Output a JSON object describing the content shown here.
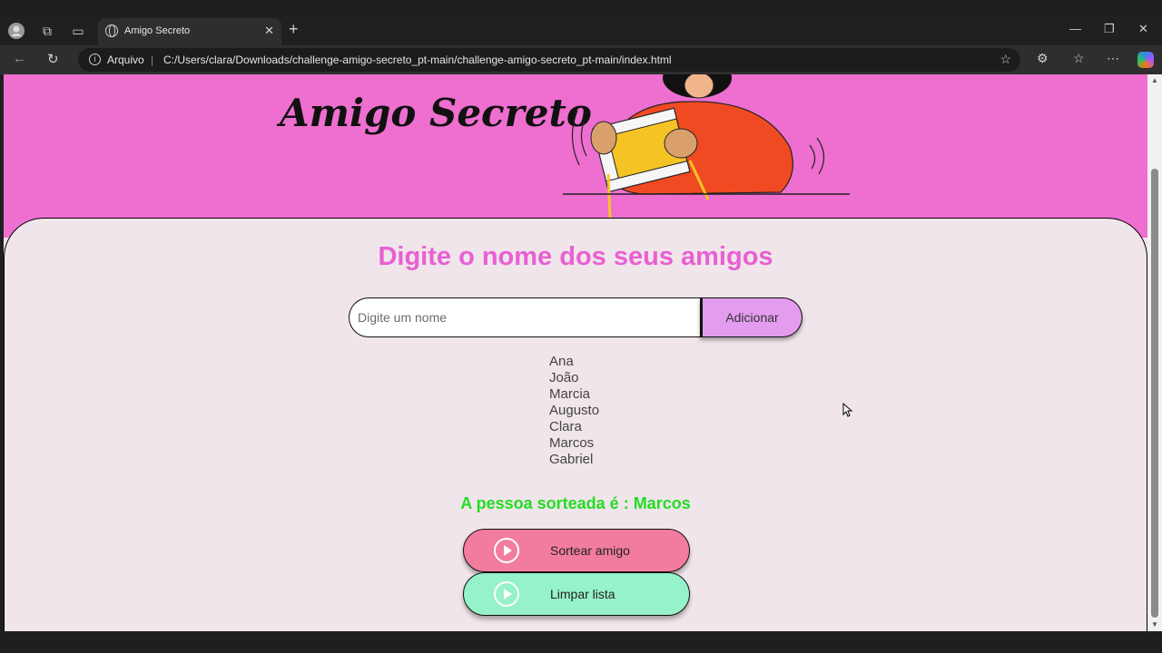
{
  "browser": {
    "tab_title": "Amigo Secreto",
    "tab_close": "✕",
    "new_tab": "+",
    "site_info_label": "Arquivo",
    "url": "C:/Users/clara/Downloads/challenge-amigo-secreto_pt-main/challenge-amigo-secreto_pt-main/index.html",
    "window_controls": [
      "—",
      "❐",
      "✕"
    ]
  },
  "page": {
    "app_title": "Amigo Secreto",
    "section_title": "Digite o nome dos seus amigos",
    "input_placeholder": "Digite um nome",
    "add_button": "Adicionar",
    "friends": [
      "Ana",
      "João",
      "Marcia",
      "Augusto",
      "Clara",
      "Marcos",
      "Gabriel"
    ],
    "result_text": "A pessoa sorteada é : Marcos",
    "draw_button": "Sortear amigo",
    "clear_button": "Limpar lista"
  },
  "colors": {
    "header_bg": "#ee6fd0",
    "title_accent": "#e860d3",
    "add_button_bg": "#e49cf0",
    "result_text": "#22dd22",
    "draw_button_bg": "#f27c9e",
    "clear_button_bg": "#96f2c8"
  }
}
